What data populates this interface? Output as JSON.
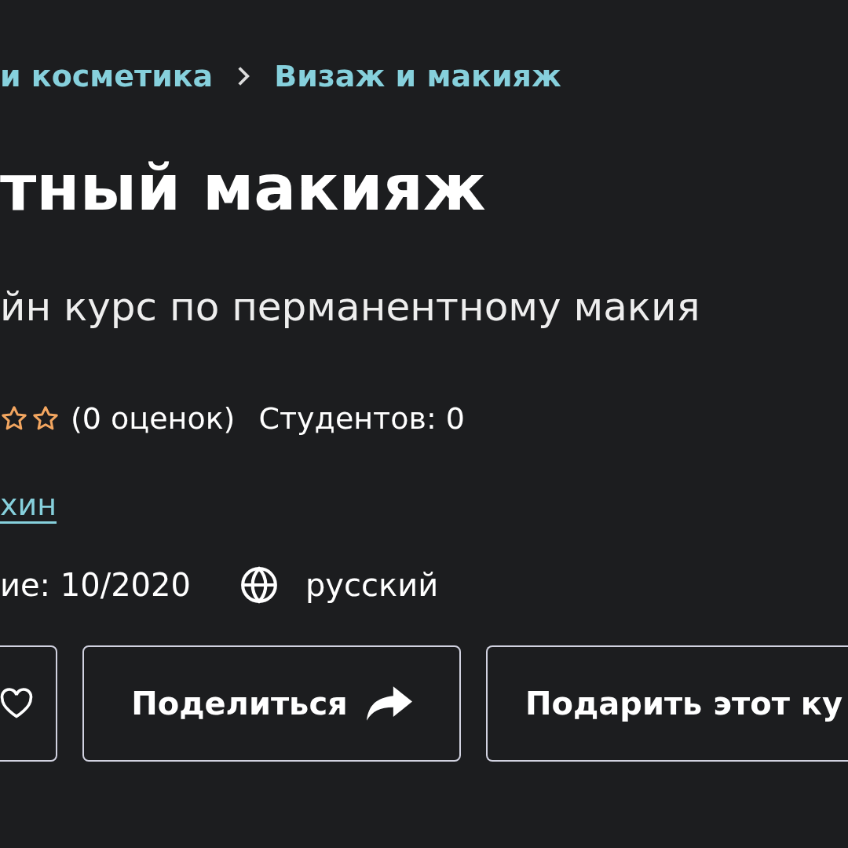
{
  "breadcrumb": [
    {
      "label": "и косметика"
    },
    {
      "label": "Визаж и макияж"
    }
  ],
  "title": "тный макияж",
  "subtitle": "йн курс по перманентному макия",
  "rating": {
    "count": "(0 оценок)",
    "students": "Студентов: 0"
  },
  "author_link": "хин",
  "updated": "ие: 10/2020",
  "language": "русский",
  "buttons": [
    {
      "kind": "wishlist"
    },
    {
      "kind": "share",
      "label": "Поделиться"
    },
    {
      "kind": "gift",
      "label": "Подарить этот ку"
    }
  ]
}
